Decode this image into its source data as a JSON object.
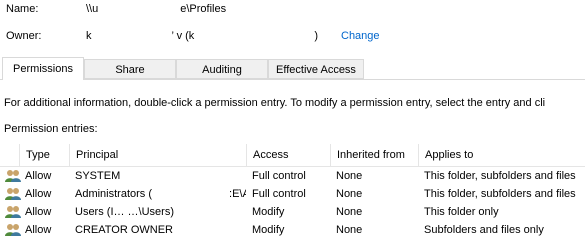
{
  "header": {
    "name_label": "Name:",
    "name_value_prefix": "\\\\u",
    "name_value_suffix": "e\\Profiles",
    "owner_label": "Owner:",
    "owner_value_a": "k",
    "owner_value_b": "’ v (k",
    "owner_value_c": ")",
    "change_link": "Change"
  },
  "tabs": [
    {
      "label": "Permissions",
      "active": true
    },
    {
      "label": "Share",
      "active": false
    },
    {
      "label": "Auditing",
      "active": false
    },
    {
      "label": "Effective Access",
      "active": false
    }
  ],
  "info_text": "For additional information, double-click a permission entry. To modify a permission entry, select the entry and cli",
  "entries_label": "Permission entries:",
  "table": {
    "headers": [
      "Type",
      "Principal",
      "Access",
      "Inherited from",
      "Applies to"
    ],
    "rows": [
      {
        "type": "Allow",
        "principal": "SYSTEM",
        "access": "Full control",
        "inherited": "None",
        "applies": "This folder, subfolders and files"
      },
      {
        "type": "Allow",
        "principal": "Administrators (       :E\\A...",
        "access": "Full control",
        "inherited": "None",
        "applies": "This folder, subfolders and files"
      },
      {
        "type": "Allow",
        "principal": "Users (I… …\\Users)",
        "access": "Modify",
        "inherited": "None",
        "applies": "This folder only"
      },
      {
        "type": "Allow",
        "principal": "CREATOR OWNER",
        "access": "Modify",
        "inherited": "None",
        "applies": "Subfolders and files only"
      }
    ]
  },
  "colors": {
    "link": "#0066cc",
    "tab_inactive_bg": "#f0f0f0",
    "border": "#d9d9d9",
    "icon_green": "#4f8a3c",
    "icon_tan": "#c9a46b"
  }
}
